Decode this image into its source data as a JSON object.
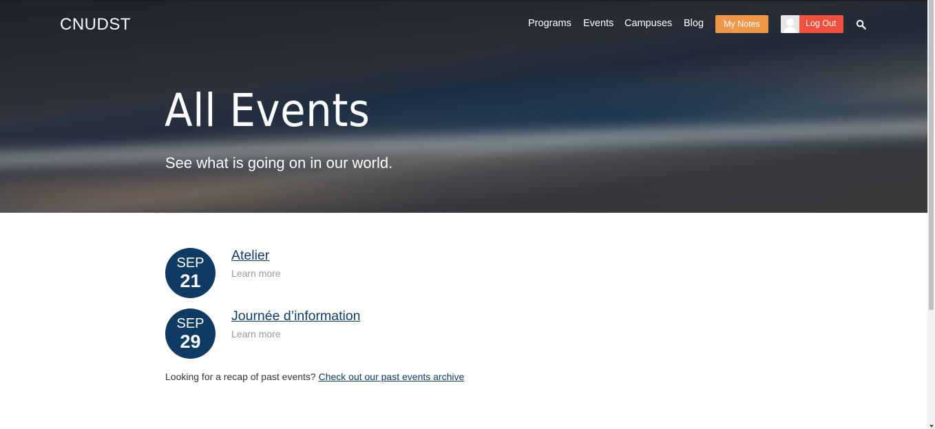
{
  "header": {
    "logo": "CNUDST",
    "nav": [
      {
        "label": "Programs"
      },
      {
        "label": "Events"
      },
      {
        "label": "Campuses"
      },
      {
        "label": "Blog"
      }
    ],
    "my_notes_label": "My Notes",
    "logout_label": "Log Out",
    "icons": {
      "search": "search-icon",
      "avatar": "user-avatar-icon"
    },
    "colors": {
      "my_notes": "#f0974a",
      "logout": "#f2503e"
    }
  },
  "hero": {
    "title": "All Events",
    "subtitle": "See what is going on in our world."
  },
  "events": [
    {
      "month": "SEP",
      "day": "21",
      "title": "Atelier",
      "more": "Learn more"
    },
    {
      "month": "SEP",
      "day": "29",
      "title": "Journée d’information",
      "more": "Learn more"
    }
  ],
  "recap": {
    "text": "Looking for a recap of past events?",
    "link": "Check out our past events archive"
  },
  "colors": {
    "badge": "#0e3a63",
    "link": "#0e3a63"
  }
}
